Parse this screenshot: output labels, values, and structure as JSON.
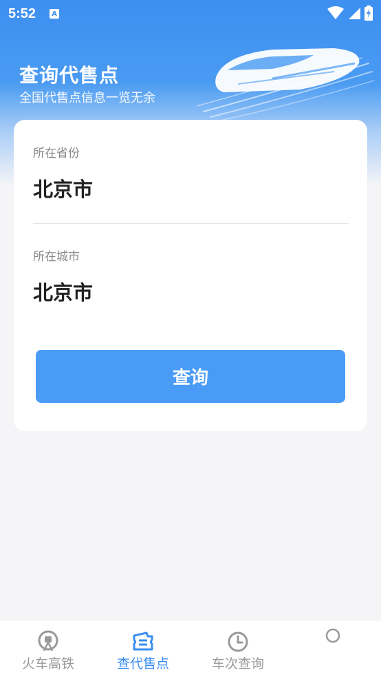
{
  "status_bar": {
    "time": "5:52",
    "notification_badge": "A",
    "icons": [
      "wifi-icon",
      "signal-icon",
      "battery-charging-icon"
    ]
  },
  "header": {
    "title": "查询代售点",
    "subtitle": "全国代售点信息一览无余"
  },
  "form": {
    "province_label": "所在省份",
    "province_value": "北京市",
    "city_label": "所在城市",
    "city_value": "北京市",
    "query_button": "查询"
  },
  "bottom_nav": {
    "items": [
      {
        "label": "火车高铁",
        "icon": "train-icon",
        "active": false
      },
      {
        "label": "查代售点",
        "icon": "ticket-icon",
        "active": true
      },
      {
        "label": "车次查询",
        "icon": "clock-icon",
        "active": false
      },
      {
        "label": "",
        "icon": "circle-icon",
        "active": false
      }
    ]
  },
  "colors": {
    "primary": "#3d8ff0",
    "button": "#4a9bf5",
    "active_nav": "#3a8ef0",
    "inactive_nav": "#999999"
  }
}
